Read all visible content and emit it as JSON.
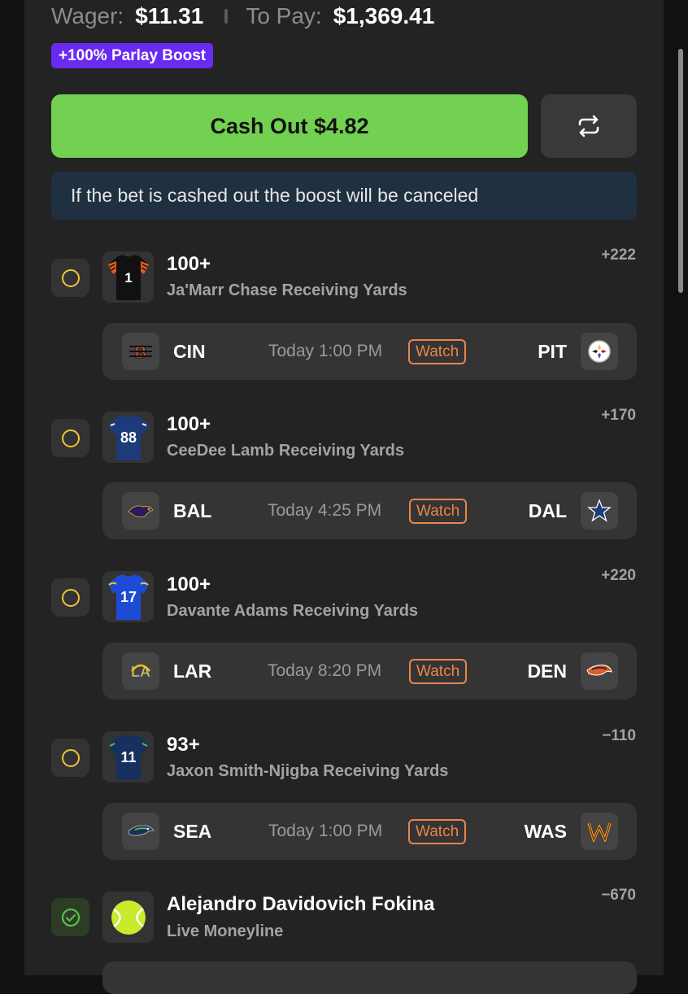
{
  "summary": {
    "wager_label": "Wager:",
    "wager_value": "$11.31",
    "topay_label": "To Pay:",
    "topay_value": "$1,369.41",
    "boost_badge": "+100% Parlay Boost"
  },
  "actions": {
    "cashout_label": "Cash Out $4.82",
    "refresh_icon": "refresh-icon"
  },
  "notice": "If the bet is cashed out the boost will be canceled",
  "colors": {
    "cashout": "#73d151",
    "boost": "#6a2bf0",
    "watch": "#e8864a",
    "pending": "#f0c53a",
    "won": "#5bbf4a"
  },
  "legs": [
    {
      "line": "100+",
      "market": "Ja'Marr Chase Receiving Yards",
      "odds": "+222",
      "jersey_number": "1",
      "status": "pending",
      "game": {
        "away": "CIN",
        "time": "Today 1:00 PM",
        "watch": "Watch",
        "home": "PIT"
      }
    },
    {
      "line": "100+",
      "market": "CeeDee Lamb Receiving Yards",
      "odds": "+170",
      "jersey_number": "88",
      "status": "pending",
      "game": {
        "away": "BAL",
        "time": "Today 4:25 PM",
        "watch": "Watch",
        "home": "DAL"
      }
    },
    {
      "line": "100+",
      "market": "Davante Adams Receiving Yards",
      "odds": "+220",
      "jersey_number": "17",
      "status": "pending",
      "game": {
        "away": "LAR",
        "time": "Today 8:20 PM",
        "watch": "Watch",
        "home": "DEN"
      }
    },
    {
      "line": "93+",
      "market": "Jaxon Smith-Njigba Receiving Yards",
      "odds": "−110",
      "jersey_number": "11",
      "status": "pending",
      "game": {
        "away": "SEA",
        "time": "Today 1:00 PM",
        "watch": "Watch",
        "home": "WAS"
      }
    },
    {
      "line": "Alejandro Davidovich Fokina",
      "market": "Live Moneyline",
      "odds": "−670",
      "status": "won"
    }
  ]
}
